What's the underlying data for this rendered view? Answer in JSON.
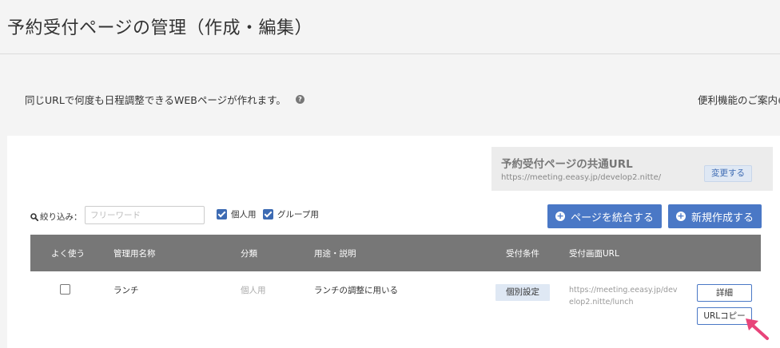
{
  "header": {
    "title": "予約受付ページの管理（作成・編集）"
  },
  "intro": {
    "text": "同じURLで何度も日程調整できるWEBページが作れます。",
    "help_icon": "question-circle-icon",
    "guide_link": "便利機能のご案内"
  },
  "common_url": {
    "title": "予約受付ページの共通URL",
    "url": "https://meeting.eeasy.jp/develop2.nitte/",
    "change_label": "変更する"
  },
  "filter": {
    "label": "絞り込み：",
    "placeholder": "フリーワード",
    "personal_label": "個人用",
    "personal_checked": true,
    "group_label": "グループ用",
    "group_checked": true
  },
  "actions": {
    "merge_label": "ページを統合する",
    "new_label": "新規作成する"
  },
  "table": {
    "columns": [
      "よく使う",
      "管理用名称",
      "分類",
      "用途・説明",
      "受付条件",
      "受付画面URL"
    ],
    "rows": [
      {
        "favorite": false,
        "name": "ランチ",
        "category": "個人用",
        "description": "ランチの調整に用いる",
        "condition": "個別設定",
        "url": "https://meeting.eeasy.jp/develop2.nitte/lunch",
        "detail_label": "詳細",
        "copy_label": "URLコピー"
      }
    ]
  },
  "colors": {
    "accent": "#4a78c6",
    "header_row": "#777777",
    "badge_bg": "#dfe8f4",
    "arrow": "#e8447a"
  }
}
